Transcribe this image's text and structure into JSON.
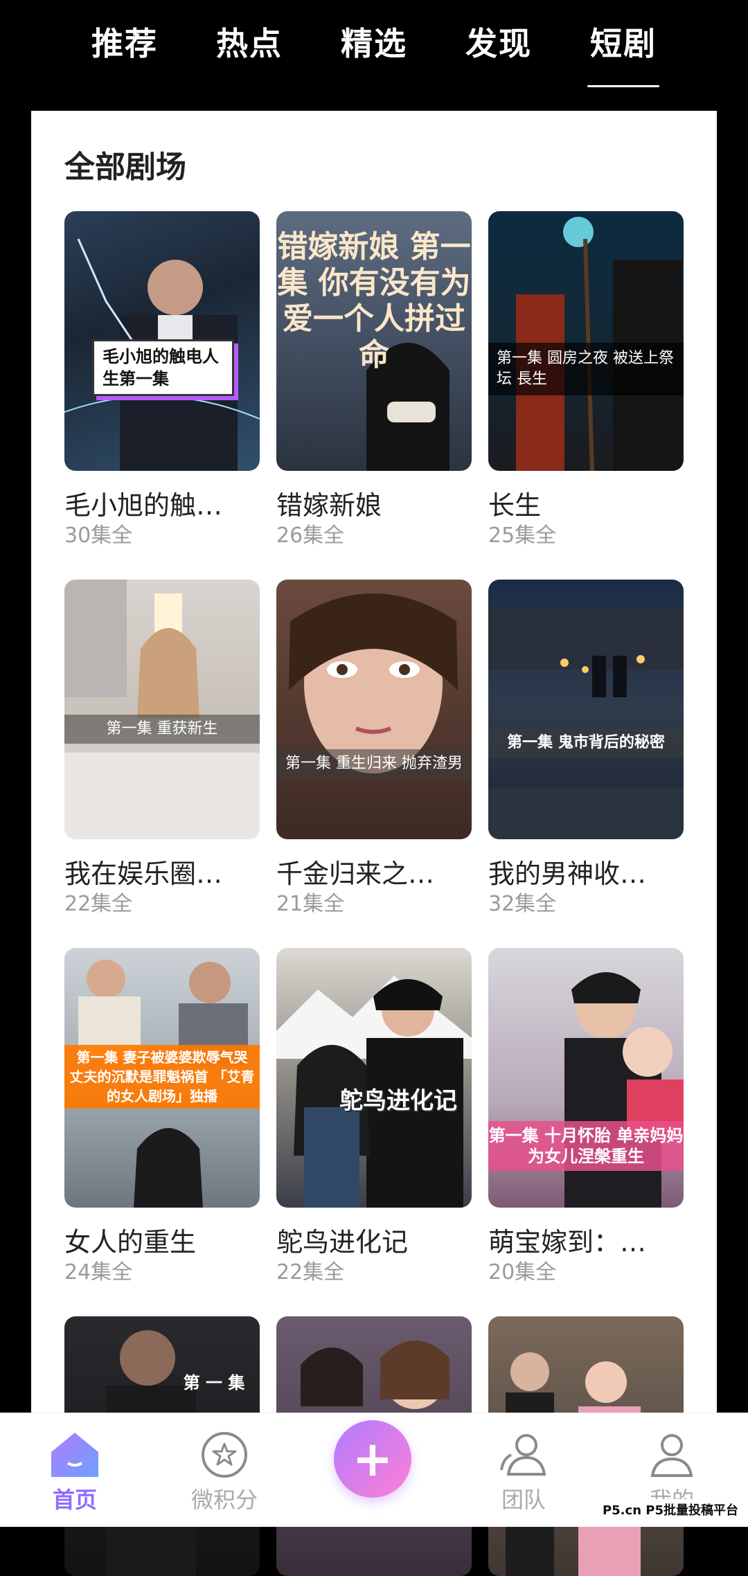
{
  "top_tabs": [
    {
      "label": "推荐"
    },
    {
      "label": "热点"
    },
    {
      "label": "精选"
    },
    {
      "label": "发现"
    },
    {
      "label": "短剧",
      "active": true
    }
  ],
  "section": {
    "title": "全部剧场"
  },
  "dramas": [
    {
      "title": "毛小旭的触…",
      "episodes": "30集全",
      "poster_caption": "毛小旭的触电人生第一集",
      "poster_theme": "office-night"
    },
    {
      "title": "错嫁新娘",
      "episodes": "26集全",
      "poster_caption": "错嫁新娘 第一集 你有没有为爱一个人拼过命",
      "poster_theme": "bride"
    },
    {
      "title": "长生",
      "episodes": "25集全",
      "poster_caption": "第一集 圆房之夜 被送上祭坛 長生",
      "poster_theme": "dark-fantasy"
    },
    {
      "title": "我在娱乐圈…",
      "episodes": "22集全",
      "poster_caption": "第一集 重获新生",
      "poster_theme": "bedroom"
    },
    {
      "title": "千金归来之…",
      "episodes": "21集全",
      "poster_caption": "第一集 重生归来 抛弃渣男",
      "poster_theme": "closeup"
    },
    {
      "title": "我的男神收…",
      "episodes": "32集全",
      "poster_caption": "第一集 鬼市背后的秘密",
      "poster_theme": "night-street"
    },
    {
      "title": "女人的重生",
      "episodes": "24集全",
      "poster_caption": "第一集 妻子被婆婆欺辱气哭 丈夫的沉默是罪魁祸首 「艾青的女人剧场」独播",
      "poster_theme": "family"
    },
    {
      "title": "鸵鸟进化记",
      "episodes": "22集全",
      "poster_caption": "鸵鸟进化记",
      "poster_theme": "romance"
    },
    {
      "title": "萌宝嫁到：…",
      "episodes": "20集全",
      "poster_caption": "第一集 十月怀胎 单亲妈妈 为女儿涅槃重生",
      "poster_theme": "romance-pink"
    },
    {
      "title": "",
      "episodes": "",
      "poster_caption": "第 一 集",
      "poster_theme": "dark-drama"
    },
    {
      "title": "",
      "episodes": "",
      "poster_caption": "",
      "poster_theme": "two-women"
    },
    {
      "title": "",
      "episodes": "",
      "poster_caption": "",
      "poster_theme": "party"
    }
  ],
  "bottom_nav": [
    {
      "label": "首页",
      "icon": "home-icon",
      "active": true
    },
    {
      "label": "微积分",
      "icon": "star-circle-icon"
    },
    {
      "label": "+",
      "icon": "plus-icon"
    },
    {
      "label": "团队",
      "icon": "team-icon"
    },
    {
      "label": "我的",
      "icon": "profile-icon"
    }
  ],
  "colors": {
    "accent": "#8f6bff",
    "plus_gradient_start": "#b07cff",
    "plus_gradient_end": "#ff7fd6"
  },
  "watermark": "P5.cn P5批量投稿平台"
}
